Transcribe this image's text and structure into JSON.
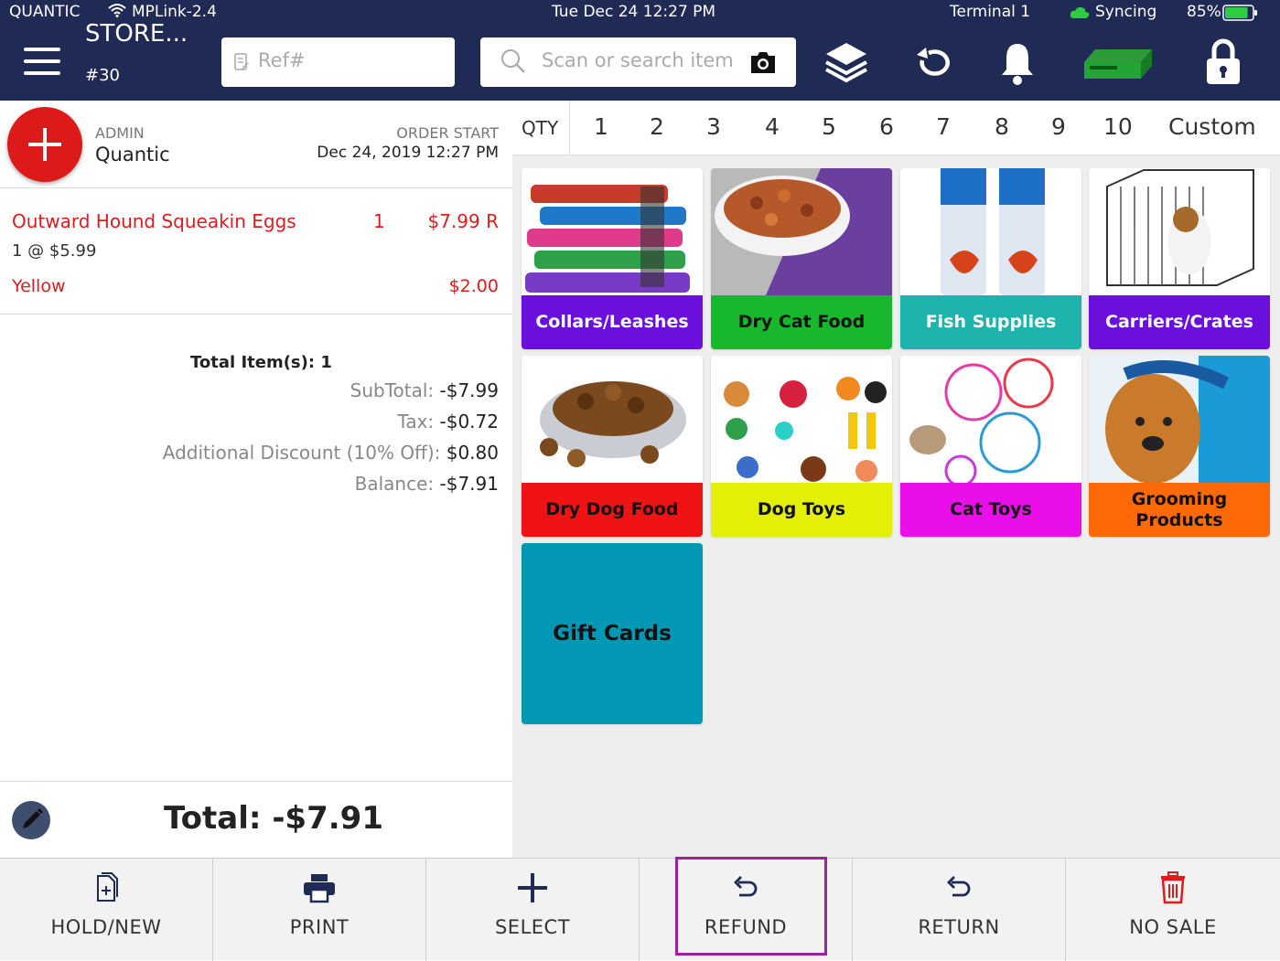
{
  "status_bar": {
    "brand": "QUANTIC",
    "network": "MPLink-2.4",
    "datetime": "Tue Dec 24 12:27 PM",
    "terminal": "Terminal 1",
    "sync_status": "Syncing",
    "battery": "85%",
    "battery_level": 0.85
  },
  "header": {
    "store_name": "STORE...",
    "store_number": "#30",
    "ref_placeholder": "Ref#",
    "search_placeholder": "Scan or search item"
  },
  "order": {
    "role": "ADMIN",
    "user": "Quantic",
    "order_start_label": "ORDER START",
    "order_start": "Dec 24, 2019 12:27 PM",
    "items": [
      {
        "name": "Outward Hound Squeakin Eggs",
        "qty": "1",
        "price": "$7.99 R",
        "unit": "1 @ $5.99",
        "modifier_name": "Yellow",
        "modifier_price": "$2.00"
      }
    ],
    "total_items": "Total Item(s): 1",
    "subtotal_label": "SubTotal:",
    "subtotal": "-$7.99",
    "tax_label": "Tax:",
    "tax": "-$0.72",
    "discount_label": "Additional Discount (10% Off):",
    "discount": "$0.80",
    "balance_label": "Balance:",
    "balance": "-$7.91",
    "grand_total": "Total: -$7.91"
  },
  "qty_bar": {
    "label": "QTY",
    "options": [
      "1",
      "2",
      "3",
      "4",
      "5",
      "6",
      "7",
      "8",
      "9",
      "10",
      "Custom"
    ]
  },
  "categories": [
    {
      "label": "Collars/Leashes",
      "color": "#6a0fdc",
      "text_color": "#ffffff"
    },
    {
      "label": "Dry Cat Food",
      "color": "#17b82b",
      "text_color": "#111111"
    },
    {
      "label": "Fish Supplies",
      "color": "#1fb3ad",
      "text_color": "#ffffff"
    },
    {
      "label": "Carriers/Crates",
      "color": "#6a0fdc",
      "text_color": "#ffffff"
    },
    {
      "label": "Dry Dog Food",
      "color": "#f01313",
      "text_color": "#111111"
    },
    {
      "label": "Dog Toys",
      "color": "#e4ef06",
      "text_color": "#111111"
    },
    {
      "label": "Cat Toys",
      "color": "#ea0eea",
      "text_color": "#111111"
    },
    {
      "label": "Grooming Products",
      "color": "#ff6a07",
      "text_color": "#111111"
    },
    {
      "label": "Gift Cards",
      "color": "#0197b5",
      "text_color": "#111111"
    }
  ],
  "actions": {
    "hold_new": "HOLD/NEW",
    "print": "PRINT",
    "select": "SELECT",
    "refund": "REFUND",
    "return": "RETURN",
    "no_sale": "NO SALE"
  },
  "colors": {
    "header_bg": "#1f2a55",
    "accent_red": "#dd1a1a",
    "highlight_outline": "#a020a0"
  }
}
